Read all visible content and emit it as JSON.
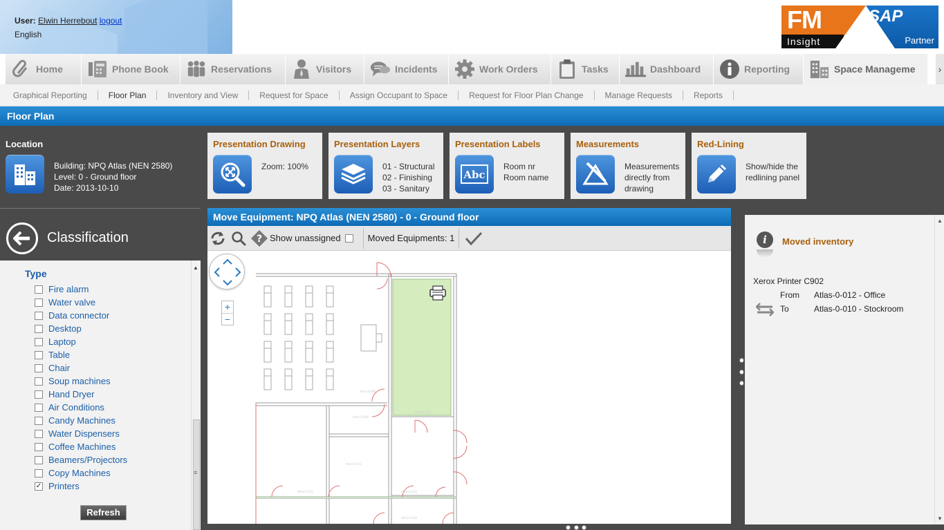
{
  "user": {
    "label": "User:",
    "name": "Elwin Herrebout",
    "logout": "logout",
    "language": "English"
  },
  "logo": {
    "fm": "FM",
    "insight": "Insight",
    "sap": "SAP",
    "partner": "Partner"
  },
  "tabs": [
    {
      "label": "Home",
      "icon": "paperclip-icon"
    },
    {
      "label": "Phone Book",
      "icon": "phone-book-icon"
    },
    {
      "label": "Reservations",
      "icon": "people-icon"
    },
    {
      "label": "Visitors",
      "icon": "visitor-icon"
    },
    {
      "label": "Incidents",
      "icon": "speech-bubble-icon"
    },
    {
      "label": "Work Orders",
      "icon": "gear-icon"
    },
    {
      "label": "Tasks",
      "icon": "clipboard-icon"
    },
    {
      "label": "Dashboard",
      "icon": "bar-chart-icon"
    },
    {
      "label": "Reporting",
      "icon": "info-icon"
    },
    {
      "label": "Space Manageme",
      "icon": "buildings-icon"
    }
  ],
  "subnav": [
    "Graphical Reporting",
    "Floor Plan",
    "Inventory and View",
    "Request for Space",
    "Assign Occupant to Space",
    "Request for Floor Plan Change",
    "Manage Requests",
    "Reports"
  ],
  "page_title": "Floor Plan",
  "location": {
    "title": "Location",
    "building": "Building: NPQ Atlas (NEN 2580)",
    "level": "Level: 0 - Ground floor",
    "date": "Date: 2013-10-10"
  },
  "tools": {
    "drawing": {
      "title": "Presentation Drawing",
      "text": "Zoom: 100%"
    },
    "layers": {
      "title": "Presentation Layers",
      "l1": "01 - Structural",
      "l2": "02 - Finishing",
      "l3": "03 - Sanitary"
    },
    "labels": {
      "title": "Presentation Labels",
      "l1": "Room nr",
      "l2": "Room name"
    },
    "measure": {
      "title": "Measurements",
      "l1": "Measurements",
      "l2": "directly from",
      "l3": "drawing"
    },
    "redline": {
      "title": "Red-Lining",
      "l1": "Show/hide the",
      "l2": "redlining panel"
    }
  },
  "classification": {
    "title": "Classification",
    "type_title": "Type",
    "items": [
      {
        "label": "Fire alarm",
        "checked": false
      },
      {
        "label": "Water valve",
        "checked": false
      },
      {
        "label": "Data connector",
        "checked": false
      },
      {
        "label": "Desktop",
        "checked": false
      },
      {
        "label": "Laptop",
        "checked": false
      },
      {
        "label": "Table",
        "checked": false
      },
      {
        "label": "Chair",
        "checked": false
      },
      {
        "label": "Soup machines",
        "checked": false
      },
      {
        "label": "Hand Dryer",
        "checked": false
      },
      {
        "label": "Air Conditions",
        "checked": false
      },
      {
        "label": "Candy Machines",
        "checked": false
      },
      {
        "label": "Water Dispensers",
        "checked": false
      },
      {
        "label": "Coffee Machines",
        "checked": false
      },
      {
        "label": "Beamers/Projectors",
        "checked": false
      },
      {
        "label": "Copy Machines",
        "checked": false
      },
      {
        "label": "Printers",
        "checked": true
      }
    ],
    "refresh": "Refresh"
  },
  "map": {
    "title": "Move Equipment: NPQ Atlas (NEN 2580) - 0 - Ground floor",
    "show_unassigned": "Show unassigned",
    "moved_count": "Moved Equipments: 1",
    "highlight_color": "#d5ecbf"
  },
  "moved": {
    "title": "Moved inventory",
    "item": "Xerox Printer C902",
    "from_label": "From",
    "from_value": "Atlas-0-012 - Office",
    "to_label": "To",
    "to_value": "Atlas-0-010 - Stockroom"
  },
  "colors": {
    "accent_blue": "#1a7cc6",
    "title_orange": "#a8600d",
    "dark_band": "#4a4a4a",
    "link_blue": "#1c5fa8"
  }
}
